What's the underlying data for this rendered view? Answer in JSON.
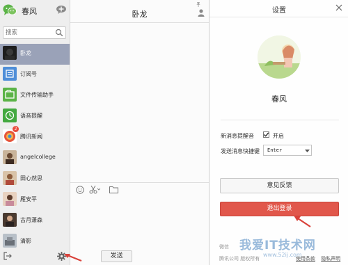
{
  "colors": {
    "sidebar_bg": "#eeeeee",
    "selected_bg": "#9aa2b8",
    "logout_red": "#e1574b",
    "wechat_green": "#5bb347",
    "arrow_red": "#d9413a",
    "watermark_blue": "#4682be"
  },
  "sidebar": {
    "username": "春风",
    "logo_icon": "wechat-logo-icon",
    "search": {
      "placeholder": "搜索"
    },
    "contacts": [
      {
        "name": "卧龙",
        "selected": true,
        "icon": "dark-avatar"
      },
      {
        "name": "订阅号",
        "icon": "subscription-icon"
      },
      {
        "name": "文件传输助手",
        "icon": "file-transfer-icon"
      },
      {
        "name": "语音提醒",
        "icon": "voice-reminder-icon"
      },
      {
        "name": "腾讯新闻",
        "badge": "2",
        "icon": "tencent-news-icon"
      },
      {
        "name": "angelcollege",
        "icon": "photo-avatar"
      },
      {
        "name": "田心然思",
        "icon": "photo-avatar"
      },
      {
        "name": "雁安平",
        "icon": "photo-avatar"
      },
      {
        "name": "古月潇森",
        "icon": "photo-avatar"
      },
      {
        "name": "清影",
        "icon": "photo-avatar"
      }
    ]
  },
  "chat": {
    "title": "卧龙",
    "send_label": "发送"
  },
  "settings": {
    "title": "设置",
    "profile_name": "春风",
    "notify_label": "新消息提醒音",
    "notify_checked": true,
    "notify_option": "开启",
    "send_key_label": "发送消息快捷键",
    "send_key_value": "Enter",
    "feedback_label": "意见反馈",
    "logout_label": "退出登录",
    "footer_line1": "微信",
    "footer_line2": "腾讯公司 版权所有",
    "footer_link1": "使用条款",
    "footer_link2": "隐私声明"
  },
  "watermark": {
    "text": "我爱IT技术网",
    "url": "www.52ij.com"
  }
}
